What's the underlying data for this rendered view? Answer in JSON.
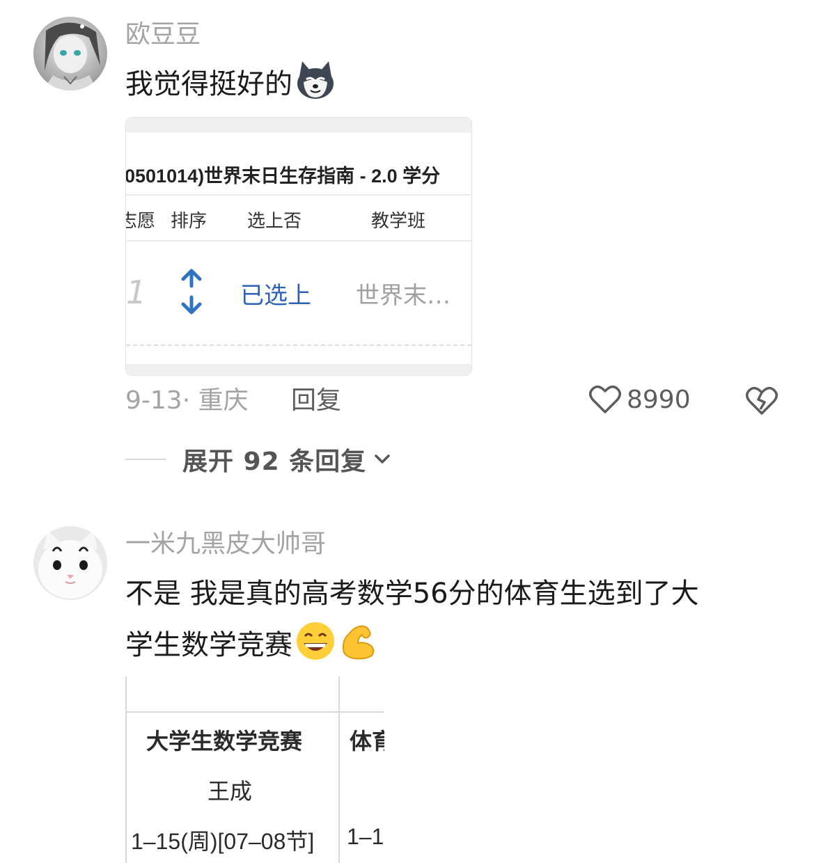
{
  "comments": [
    {
      "username": "欧豆豆",
      "text": "我觉得挺好的",
      "emojis": [
        "wolf-emoji"
      ],
      "attachment": {
        "course_title": "0501014)世界末日生存指南 - 2.0 学分",
        "headers": [
          "志愿",
          "排序",
          "选上否",
          "教学班"
        ],
        "row": {
          "index": "1",
          "status": "已选上",
          "class_name": "世界末…"
        }
      },
      "date": "9-13",
      "location": "重庆",
      "reply_label": "回复",
      "like_count": "8990",
      "expand_label": "展开 92 条回复"
    },
    {
      "username": "一米九黑皮大帅哥",
      "text_line1": "不是 我是真的高考数学56分的体育生选到了大",
      "text_line2": "学生数学竞赛",
      "emojis": [
        "grin-emoji",
        "flex-emoji"
      ],
      "attachment": {
        "col1_row1": "大学生数学竞赛",
        "col1_row2": "王成",
        "col1_row3": "1–15(周)[07–08节]",
        "col2_row1": "体育",
        "col2_row3": "1–1"
      }
    }
  ],
  "colors": {
    "link_blue": "#2d62b6",
    "meta_gray": "#a3a3a3",
    "arrow_blue": "#2f74c0"
  }
}
